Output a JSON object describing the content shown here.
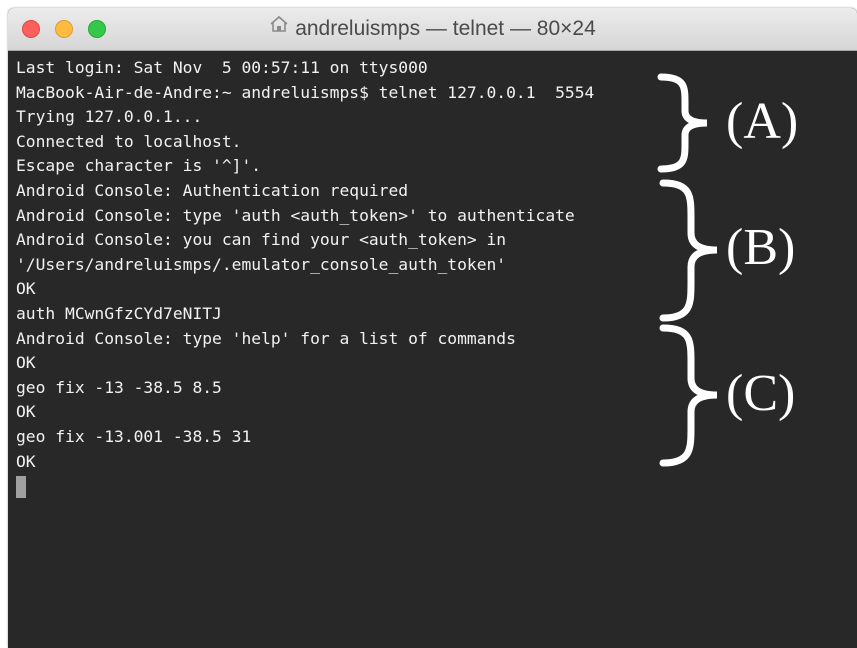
{
  "window": {
    "title": "andreluismps — telnet — 80×24"
  },
  "terminal": {
    "lines": [
      "Last login: Sat Nov  5 00:57:11 on ttys000",
      "MacBook-Air-de-Andre:~ andreluismps$ telnet 127.0.0.1  5554",
      "Trying 127.0.0.1...",
      "Connected to localhost.",
      "Escape character is '^]'.",
      "Android Console: Authentication required",
      "Android Console: type 'auth <auth_token>' to authenticate",
      "Android Console: you can find your <auth_token> in",
      "'/Users/andreluismps/.emulator_console_auth_token'",
      "OK",
      "auth MCwnGfzCYd7eNITJ",
      "Android Console: type 'help' for a list of commands",
      "OK",
      "geo fix -13 -38.5 8.5",
      "OK",
      "geo fix -13.001 -38.5 31",
      "OK"
    ]
  },
  "annotations": {
    "a": "(A)",
    "b": "(B)",
    "c": "(C)"
  },
  "colors": {
    "background": "#282828",
    "text": "#f2f2f2",
    "close": "#fc605c",
    "minimize": "#fdbc40",
    "maximize": "#34c84a"
  }
}
